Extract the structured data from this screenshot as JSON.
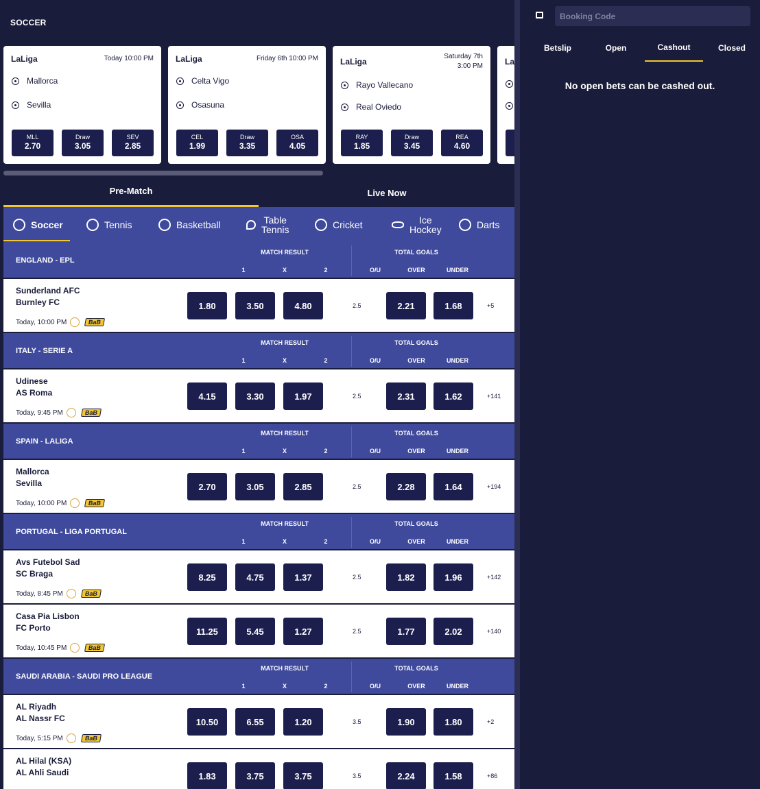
{
  "page_title": "SOCCER",
  "cards": [
    {
      "league": "LaLiga",
      "time": "Today 10:00 PM",
      "home": "Mallorca",
      "away": "Sevilla",
      "odds": [
        {
          "l": "MLL",
          "v": "2.70"
        },
        {
          "l": "Draw",
          "v": "3.05"
        },
        {
          "l": "SEV",
          "v": "2.85"
        }
      ]
    },
    {
      "league": "LaLiga",
      "time": "Friday 6th 10:00 PM",
      "home": "Celta Vigo",
      "away": "Osasuna",
      "odds": [
        {
          "l": "CEL",
          "v": "1.99"
        },
        {
          "l": "Draw",
          "v": "3.35"
        },
        {
          "l": "OSA",
          "v": "4.05"
        }
      ]
    },
    {
      "league": "LaLiga",
      "time": "Saturday 7th\n3:00 PM",
      "home": "Rayo Vallecano",
      "away": "Real Oviedo",
      "odds": [
        {
          "l": "RAY",
          "v": "1.85"
        },
        {
          "l": "Draw",
          "v": "3.45"
        },
        {
          "l": "REA",
          "v": "4.60"
        }
      ]
    },
    {
      "league": "La",
      "time": "",
      "home": "",
      "away": "",
      "odds": [
        {
          "l": "",
          "v": ""
        }
      ]
    }
  ],
  "main_tabs": [
    "Pre-Match",
    "Live Now"
  ],
  "sports": [
    {
      "label": "Soccer",
      "icon": "soccer-icon"
    },
    {
      "label": "Tennis",
      "icon": "tennis-icon"
    },
    {
      "label": "Basketball",
      "icon": "basketball-icon"
    },
    {
      "label": "Table\nTennis",
      "icon": "table-tennis-icon"
    },
    {
      "label": "Cricket",
      "icon": "cricket-icon"
    },
    {
      "label": "Ice\nHockey",
      "icon": "ice-hockey-icon"
    },
    {
      "label": "Darts",
      "icon": "darts-icon"
    }
  ],
  "headers": {
    "match_result": "MATCH RESULT",
    "total_goals": "TOTAL GOALS",
    "c1": "1",
    "cx": "X",
    "c2": "2",
    "ou": "O/U",
    "over": "OVER",
    "under": "UNDER"
  },
  "bab": "BaB",
  "leagues": [
    {
      "name": "ENGLAND - EPL",
      "matches": [
        {
          "home": "Sunderland AFC",
          "away": "Burnley FC",
          "time": "Today, 10:00 PM",
          "o1": "1.80",
          "ox": "3.50",
          "o2": "4.80",
          "ou": "2.5",
          "over": "2.21",
          "under": "1.68",
          "more": "+5"
        }
      ]
    },
    {
      "name": "ITALY - SERIE A",
      "matches": [
        {
          "home": "Udinese",
          "away": "AS Roma",
          "time": "Today, 9:45 PM",
          "o1": "4.15",
          "ox": "3.30",
          "o2": "1.97",
          "ou": "2.5",
          "over": "2.31",
          "under": "1.62",
          "more": "+141"
        }
      ]
    },
    {
      "name": "SPAIN - LALIGA",
      "matches": [
        {
          "home": "Mallorca",
          "away": "Sevilla",
          "time": "Today, 10:00 PM",
          "o1": "2.70",
          "ox": "3.05",
          "o2": "2.85",
          "ou": "2.5",
          "over": "2.28",
          "under": "1.64",
          "more": "+194"
        }
      ]
    },
    {
      "name": "PORTUGAL - LIGA PORTUGAL",
      "matches": [
        {
          "home": "Avs Futebol Sad",
          "away": "SC Braga",
          "time": "Today, 8:45 PM",
          "o1": "8.25",
          "ox": "4.75",
          "o2": "1.37",
          "ou": "2.5",
          "over": "1.82",
          "under": "1.96",
          "more": "+142"
        },
        {
          "home": "Casa Pia Lisbon",
          "away": "FC Porto",
          "time": "Today, 10:45 PM",
          "o1": "11.25",
          "ox": "5.45",
          "o2": "1.27",
          "ou": "2.5",
          "over": "1.77",
          "under": "2.02",
          "more": "+140"
        }
      ]
    },
    {
      "name": "SAUDI ARABIA - SAUDI PRO LEAGUE",
      "matches": [
        {
          "home": "AL Riyadh",
          "away": "AL Nassr FC",
          "time": "Today, 5:15 PM",
          "o1": "10.50",
          "ox": "6.55",
          "o2": "1.20",
          "ou": "3.5",
          "over": "1.90",
          "under": "1.80",
          "more": "+2"
        },
        {
          "home": "AL Hilal (KSA)",
          "away": "AL Ahli Saudi",
          "time": "",
          "o1": "1.83",
          "ox": "3.75",
          "o2": "3.75",
          "ou": "3.5",
          "over": "2.24",
          "under": "1.58",
          "more": "+86"
        }
      ]
    }
  ],
  "right": {
    "booking_placeholder": "Booking Code",
    "tabs": [
      "Betslip",
      "Open",
      "Cashout",
      "Closed"
    ],
    "active_tab": "Cashout",
    "empty_message": "No open bets can be cashed out."
  },
  "colors": {
    "accent": "#f2c72f",
    "bg": "#1a1c3b",
    "header": "#3f4a9c",
    "odds": "#1c1f4e"
  }
}
